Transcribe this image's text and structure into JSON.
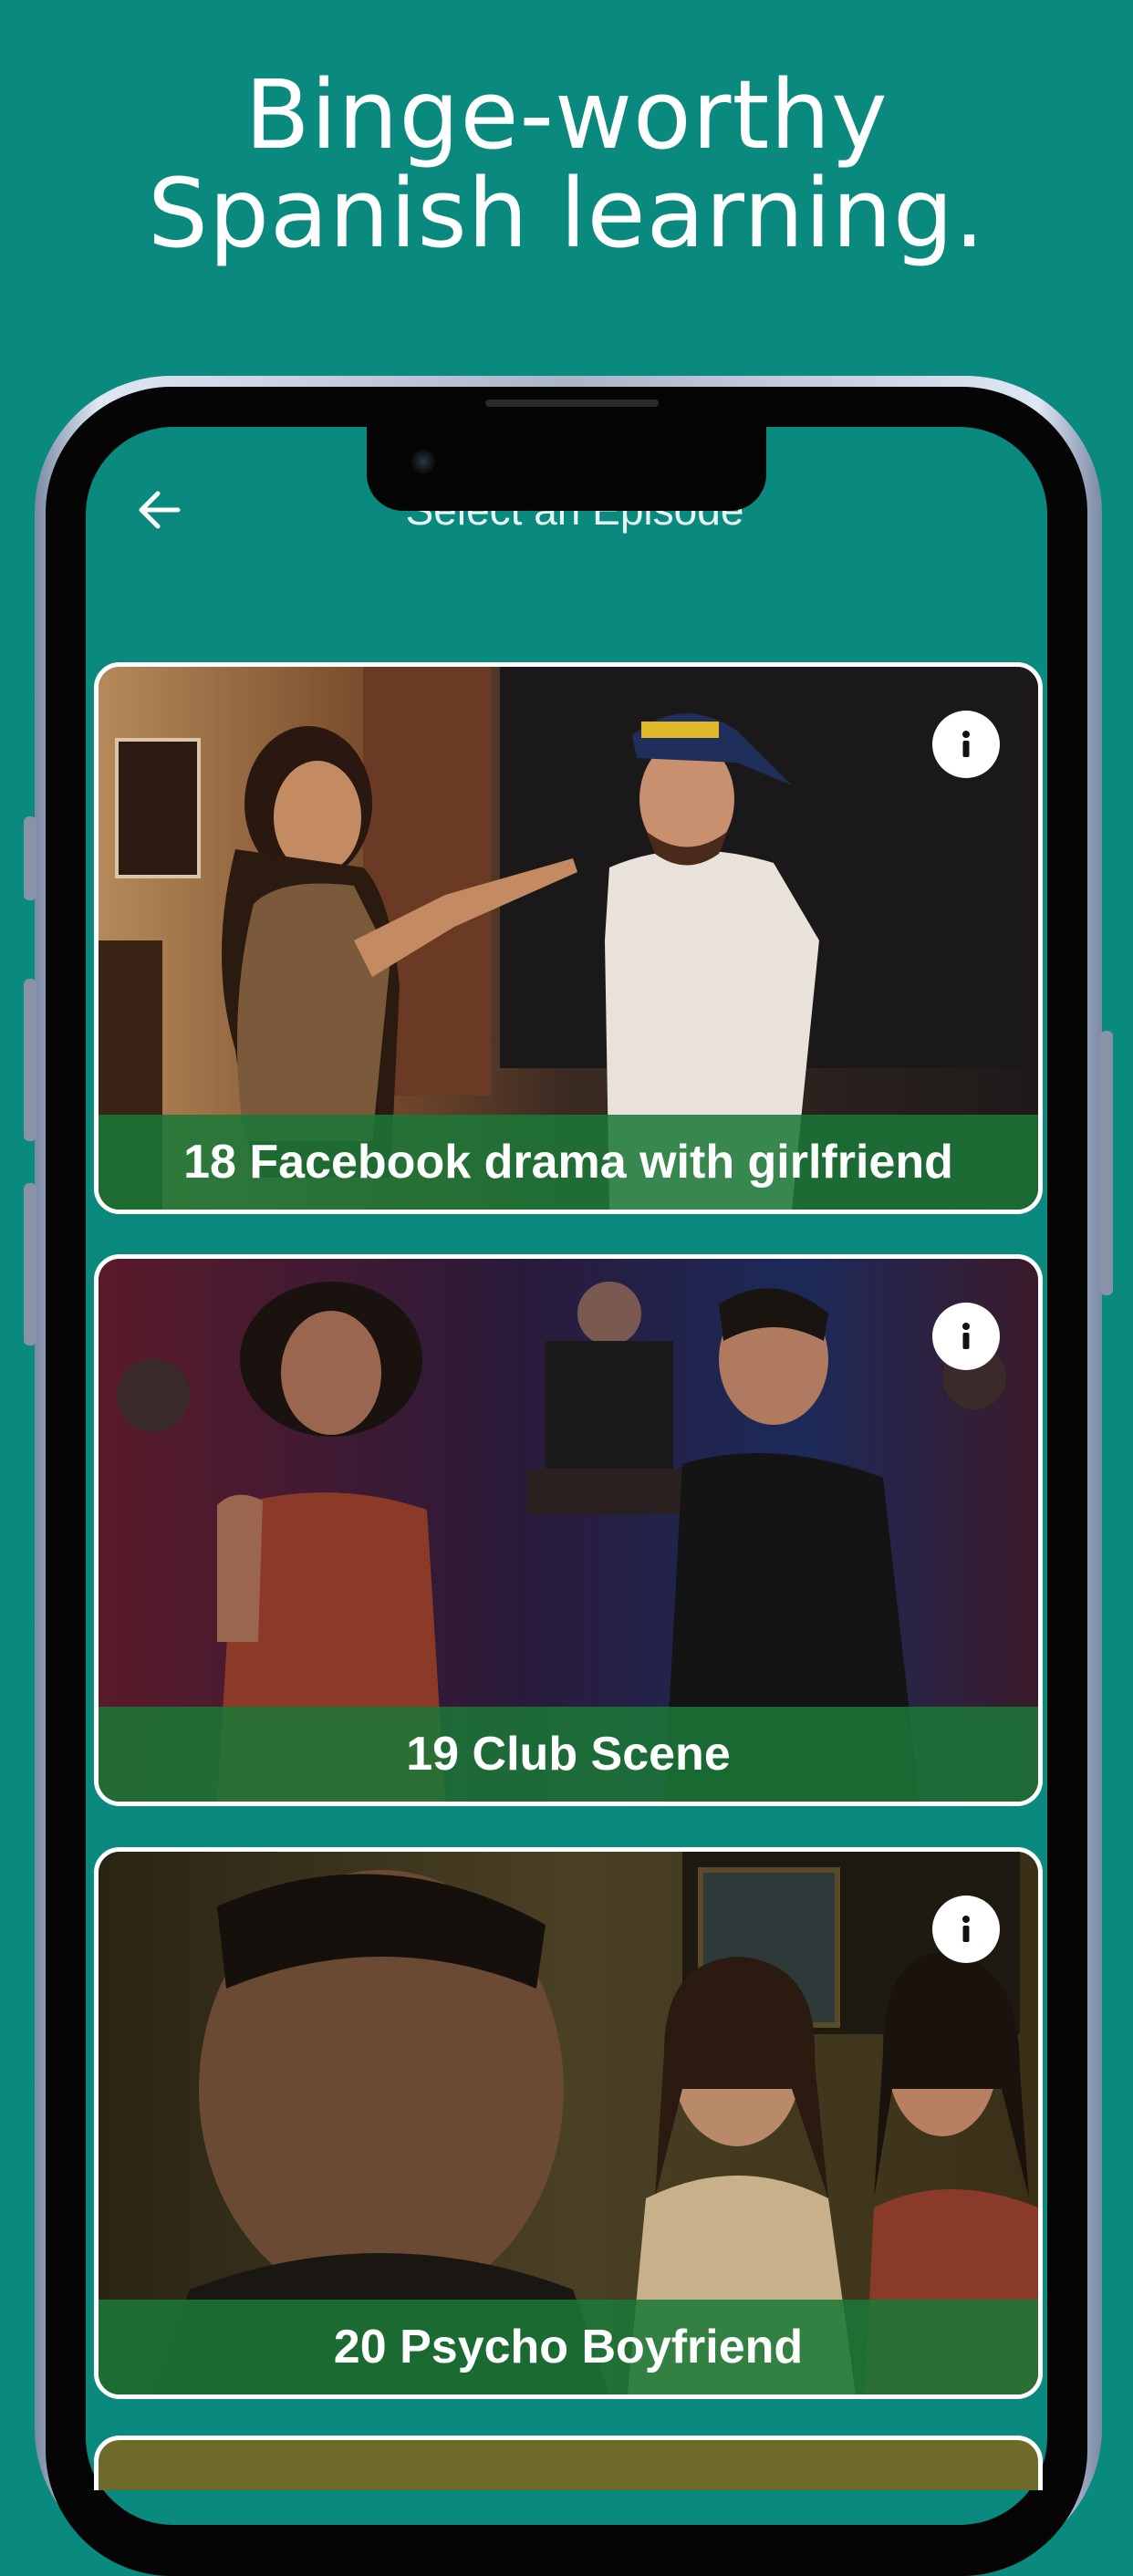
{
  "headline": {
    "line1": "Binge-worthy",
    "line2": "Spanish learning."
  },
  "nav": {
    "title": "Select an Episode",
    "back_icon": "arrow-left-icon"
  },
  "episodes": [
    {
      "label": "18 Facebook drama with girlfriend",
      "info_icon": "info-icon"
    },
    {
      "label": "19 Club Scene",
      "info_icon": "info-icon"
    },
    {
      "label": "20 Psycho Boyfriend",
      "info_icon": "info-icon"
    }
  ],
  "colors": {
    "background": "#0a8a7e",
    "caption_bar": "#1b7838",
    "card_border": "#ffffff"
  }
}
